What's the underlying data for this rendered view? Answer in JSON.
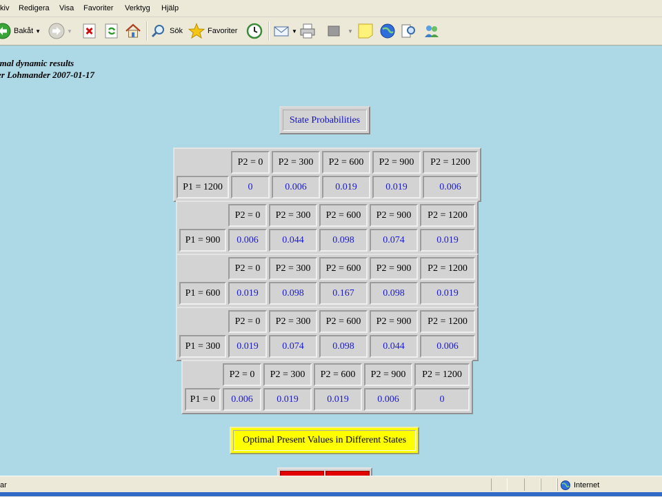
{
  "menu": [
    "kiv",
    "Redigera",
    "Visa",
    "Favoriter",
    "Verktyg",
    "Hjälp"
  ],
  "toolbar": {
    "back_label": "Bakåt",
    "search_label": "Sök",
    "favorites_label": "Favoriter"
  },
  "header": {
    "line1": "imal dynamic results",
    "line2": "er Lohmander 2007-01-17"
  },
  "state_button_label": "State Probabilities",
  "tables": [
    {
      "row": "P1 = 1200",
      "cols": [
        "P2 = 0",
        "P2 = 300",
        "P2 = 600",
        "P2 = 900",
        "P2 = 1200"
      ],
      "values": [
        "0",
        "0.006",
        "0.019",
        "0.019",
        "0.006"
      ]
    },
    {
      "row": "P1 = 900",
      "cols": [
        "P2 = 0",
        "P2 = 300",
        "P2 = 600",
        "P2 = 900",
        "P2 = 1200"
      ],
      "values": [
        "0.006",
        "0.044",
        "0.098",
        "0.074",
        "0.019"
      ]
    },
    {
      "row": "P1 = 600",
      "cols": [
        "P2 = 0",
        "P2 = 300",
        "P2 = 600",
        "P2 = 900",
        "P2 = 1200"
      ],
      "values": [
        "0.019",
        "0.098",
        "0.167",
        "0.098",
        "0.019"
      ]
    },
    {
      "row": "P1 = 300",
      "cols": [
        "P2 = 0",
        "P2 = 300",
        "P2 = 600",
        "P2 = 900",
        "P2 = 1200"
      ],
      "values": [
        "0.019",
        "0.074",
        "0.098",
        "0.044",
        "0.006"
      ]
    },
    {
      "row": "P1 = 0",
      "cols": [
        "P2 = 0",
        "P2 = 300",
        "P2 = 600",
        "P2 = 900",
        "P2 = 1200"
      ],
      "values": [
        "0.006",
        "0.019",
        "0.019",
        "0.006",
        "0"
      ]
    }
  ],
  "optimal_button_label": "Optimal Present Values in Different States",
  "status": {
    "left": "ar",
    "zone": "Internet"
  },
  "colors": {
    "page_bg": "#add8e6",
    "value_text": "#1a1ad0",
    "highlight": "#ffff00",
    "red": "#e00000"
  }
}
